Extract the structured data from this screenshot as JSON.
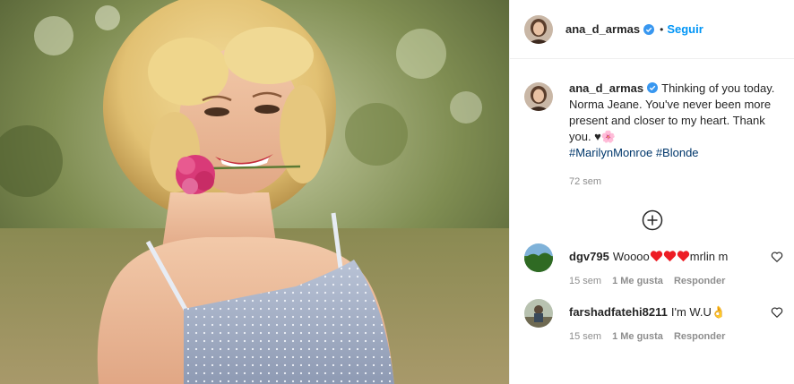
{
  "header": {
    "username": "ana_d_armas",
    "dot": "•",
    "follow_label": "Seguir"
  },
  "caption": {
    "username": "ana_d_armas",
    "text": "Thinking of you today. Norma Jeane. You've never been more present and closer to my heart. Thank you. ♥🌸",
    "hashtags": [
      "#MarilynMonroe",
      "#Blonde"
    ],
    "time": "72 sem"
  },
  "comments": [
    {
      "username": "dgv795",
      "text_before": "Woooo",
      "hearts": 3,
      "text_after": "mrlin m",
      "time": "15 sem",
      "likes": "1 Me gusta",
      "reply": "Responder"
    },
    {
      "username": "farshadfatehi8211",
      "text": "I'm W.U👌",
      "time": "15 sem",
      "likes": "1 Me gusta",
      "reply": "Responder"
    }
  ],
  "icons": {
    "verified": "verified-badge-icon",
    "more": "plus-circle-icon",
    "like": "heart-outline-icon"
  },
  "colors": {
    "link": "#0095f6",
    "hashtag": "#00376b",
    "muted": "#8e8e8e",
    "heart": "#ed1c24"
  }
}
